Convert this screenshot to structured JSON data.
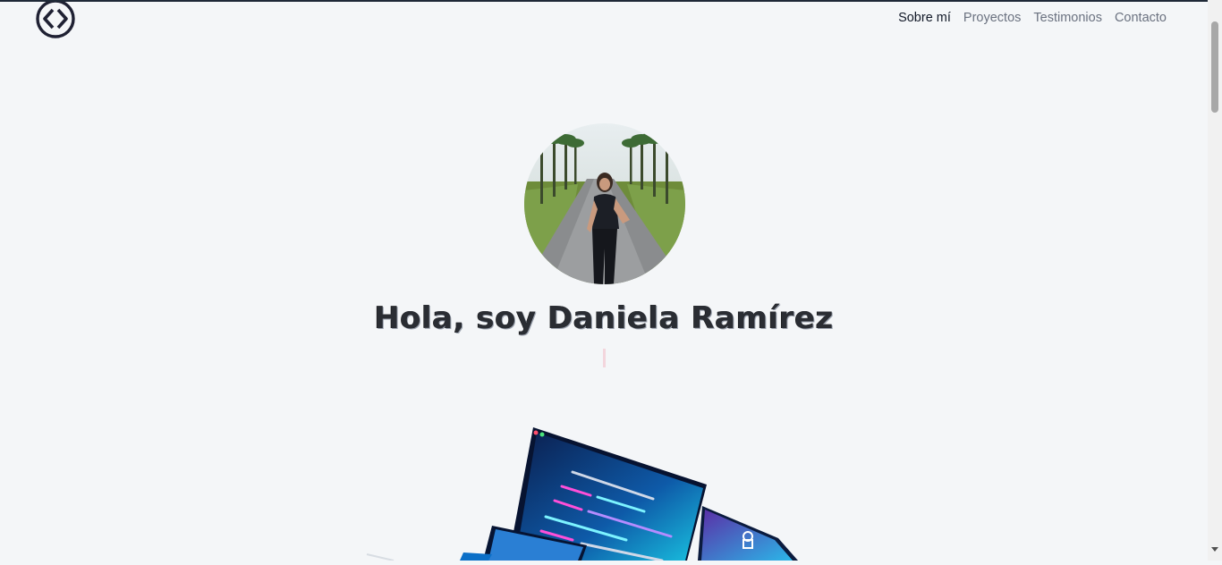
{
  "nav": {
    "items": [
      {
        "label": "Sobre mí",
        "active": true
      },
      {
        "label": "Proyectos",
        "active": false
      },
      {
        "label": "Testimonios",
        "active": false
      },
      {
        "label": "Contacto",
        "active": false
      }
    ]
  },
  "hero": {
    "title": "Hola, soy Daniela Ramírez"
  },
  "colors": {
    "background": "#f4f6f8",
    "logo": "#1f2133",
    "nav_active": "#111827",
    "nav_inactive": "#6b7280"
  },
  "icons": {
    "logo": "code-diamond-icon",
    "scroll_down": "chevron-down-icon"
  }
}
